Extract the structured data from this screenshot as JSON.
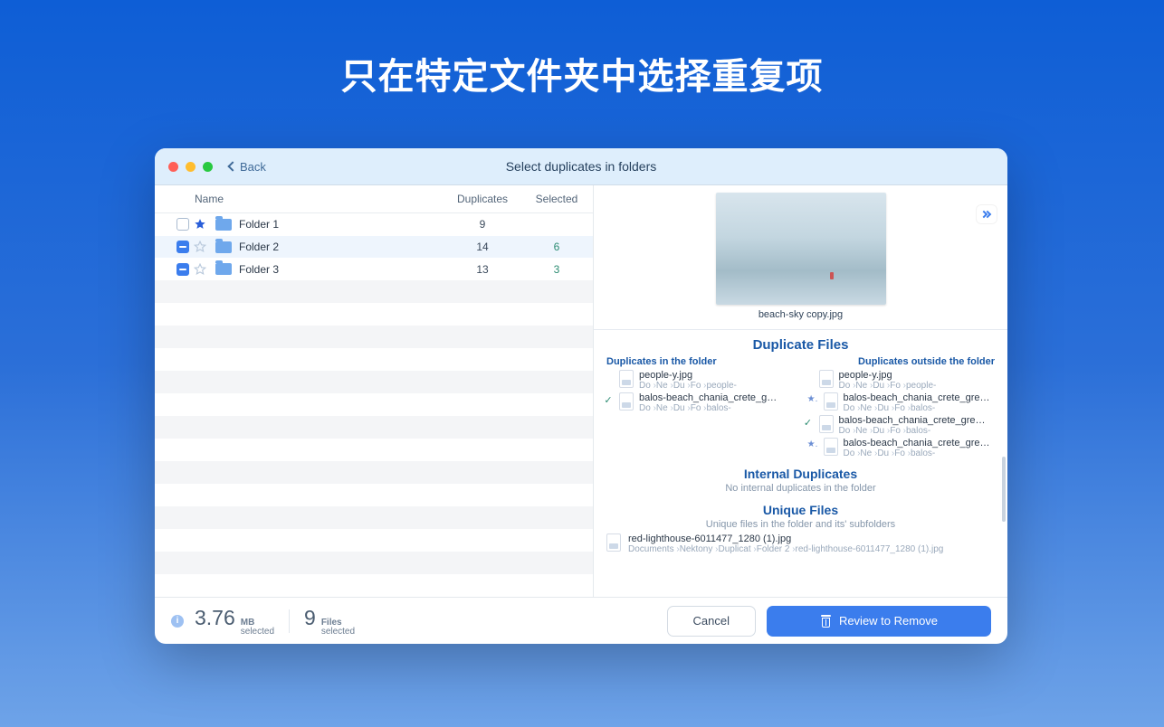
{
  "hero": "只在特定文件夹中选择重复项",
  "titlebar": {
    "back": "Back",
    "title": "Select duplicates in folders"
  },
  "left": {
    "headers": {
      "name": "Name",
      "dup": "Duplicates",
      "sel": "Selected"
    },
    "folders": [
      {
        "name": "Folder 1",
        "dup": "9",
        "sel": "",
        "starred": true,
        "check": "empty"
      },
      {
        "name": "Folder 2",
        "dup": "14",
        "sel": "6",
        "starred": false,
        "check": "indet"
      },
      {
        "name": "Folder 3",
        "dup": "13",
        "sel": "3",
        "starred": false,
        "check": "indet"
      }
    ]
  },
  "preview": {
    "filename": "beach-sky copy.jpg"
  },
  "right": {
    "duplicate_files_title": "Duplicate Files",
    "col_in": "Duplicates in the folder",
    "col_out": "Duplicates outside the folder",
    "in_items": [
      {
        "mark": "",
        "name": "people-y.jpg",
        "crumbs": [
          "Do",
          "Ne",
          "Du",
          "Fo",
          "people-"
        ]
      },
      {
        "mark": "check",
        "name": "balos-beach_chania_crete_g…",
        "crumbs": [
          "Do",
          "Ne",
          "Du",
          "Fo",
          "balos-"
        ]
      }
    ],
    "out_items": [
      {
        "mark": "",
        "name": "people-y.jpg",
        "crumbs": [
          "Do",
          "Ne",
          "Du",
          "Fo",
          "people-"
        ]
      },
      {
        "mark": "star",
        "name": "balos-beach_chania_crete_gre…",
        "crumbs": [
          "Do",
          "Ne",
          "Du",
          "Fo",
          "balos-"
        ]
      },
      {
        "mark": "check",
        "name": "balos-beach_chania_crete_gre…",
        "crumbs": [
          "Do",
          "Ne",
          "Du",
          "Fo",
          "balos-"
        ]
      },
      {
        "mark": "star",
        "name": "balos-beach_chania_crete_gre…",
        "crumbs": [
          "Do",
          "Ne",
          "Du",
          "Fo",
          "balos-"
        ]
      }
    ],
    "internal_title": "Internal Duplicates",
    "internal_note": "No internal duplicates in the folder",
    "unique_title": "Unique Files",
    "unique_note": "Unique files in the folder and its' subfolders",
    "unique_items": [
      {
        "name": "red-lighthouse-6011477_1280 (1).jpg",
        "crumbs": [
          "Documents",
          "Nektony",
          "Duplicat",
          "Folder 2",
          "red-lighthouse-6011477_1280 (1).jpg"
        ]
      }
    ]
  },
  "footer": {
    "size_value": "3.76",
    "size_unit": "MB",
    "size_label": "selected",
    "files_value": "9",
    "files_unit": "Files",
    "files_label": "selected",
    "cancel": "Cancel",
    "review": "Review to Remove"
  }
}
